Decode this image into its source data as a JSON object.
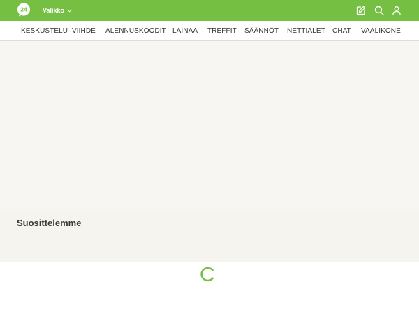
{
  "header": {
    "logo_text": "24",
    "menu_label": "Valikko",
    "icons": {
      "write": "pencil-square-icon",
      "search": "search-icon",
      "user": "user-icon",
      "chevron": "chevron-down-icon"
    }
  },
  "nav": {
    "items": [
      {
        "label": "KESKUSTELU"
      },
      {
        "label": "VIIHDE"
      },
      {
        "label": "ALENNUSKOODIT"
      },
      {
        "label": "LAINAA"
      },
      {
        "label": "TREFFIT"
      },
      {
        "label": "SÄÄNNÖT"
      },
      {
        "label": "NETTIALET"
      },
      {
        "label": "CHAT"
      },
      {
        "label": "VAALIKONE"
      }
    ]
  },
  "main": {
    "section_title": "Suosittelemme"
  },
  "colors": {
    "brand_green": "#75c043",
    "panel_bg": "#f7f6f2"
  }
}
